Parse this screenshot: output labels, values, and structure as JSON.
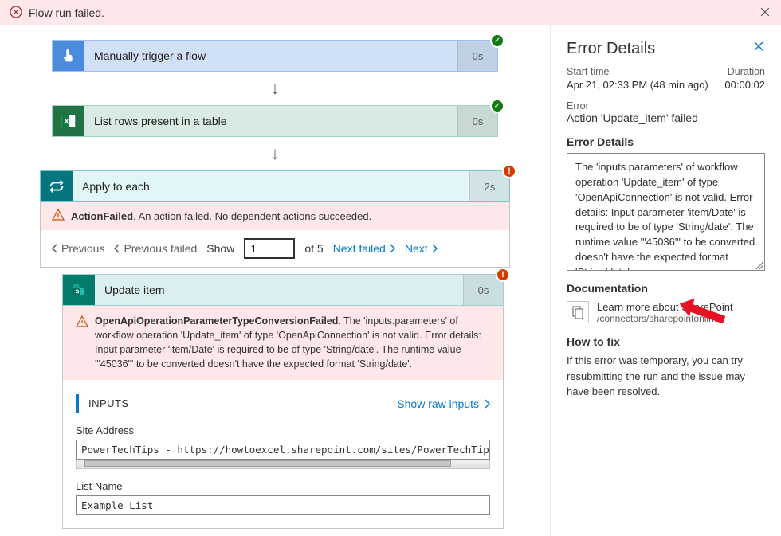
{
  "banner": {
    "text": "Flow run failed."
  },
  "steps": {
    "trigger": {
      "title": "Manually trigger a flow",
      "time": "0s"
    },
    "listrows": {
      "title": "List rows present in a table",
      "time": "0s"
    },
    "apply": {
      "title": "Apply to each",
      "time": "2s"
    },
    "update": {
      "title": "Update item",
      "time": "0s"
    }
  },
  "actionFailed": {
    "code": "ActionFailed",
    "msg": ". An action failed. No dependent actions succeeded."
  },
  "pager": {
    "prev": "Previous",
    "prevFailed": "Previous failed",
    "show": "Show",
    "index": "1",
    "of": "of 5",
    "nextFailed": "Next failed",
    "next": "Next"
  },
  "innerError": {
    "code": "OpenApiOperationParameterTypeConversionFailed",
    "msg": ". The 'inputs.parameters' of workflow operation 'Update_item' of type 'OpenApiConnection' is not valid. Error details: Input parameter 'item/Date' is required to be of type 'String/date'. The runtime value '\"45036\"' to be converted doesn't have the expected format 'String/date'."
  },
  "io": {
    "inputs": "INPUTS",
    "showRaw": "Show raw inputs"
  },
  "fields": {
    "siteAddressLabel": "Site Address",
    "siteAddressValue": "PowerTechTips - https://howtoexcel.sharepoint.com/sites/PowerTechTips",
    "listNameLabel": "List Name",
    "listNameValue": "Example List"
  },
  "details": {
    "title": "Error Details",
    "startTimeLabel": "Start time",
    "startTime": "Apr 21, 02:33 PM (48 min ago)",
    "durationLabel": "Duration",
    "duration": "00:00:02",
    "errorLabel": "Error",
    "error": "Action 'Update_item' failed",
    "boxTitle": "Error Details",
    "boxText": "The 'inputs.parameters' of workflow operation 'Update_item' of type 'OpenApiConnection' is not valid. Error details: Input parameter 'item/Date' is required to be of type 'String/date'. The runtime value '\"45036\"' to be converted doesn't have the expected format 'String/date'.",
    "docTitle": "Documentation",
    "docLink": "Learn more about SharePoint",
    "docPath": "/connectors/sharepointonline/",
    "fixTitle": "How to fix",
    "fixText": "If this error was temporary, you can try resubmitting the run and the issue may have been resolved."
  }
}
